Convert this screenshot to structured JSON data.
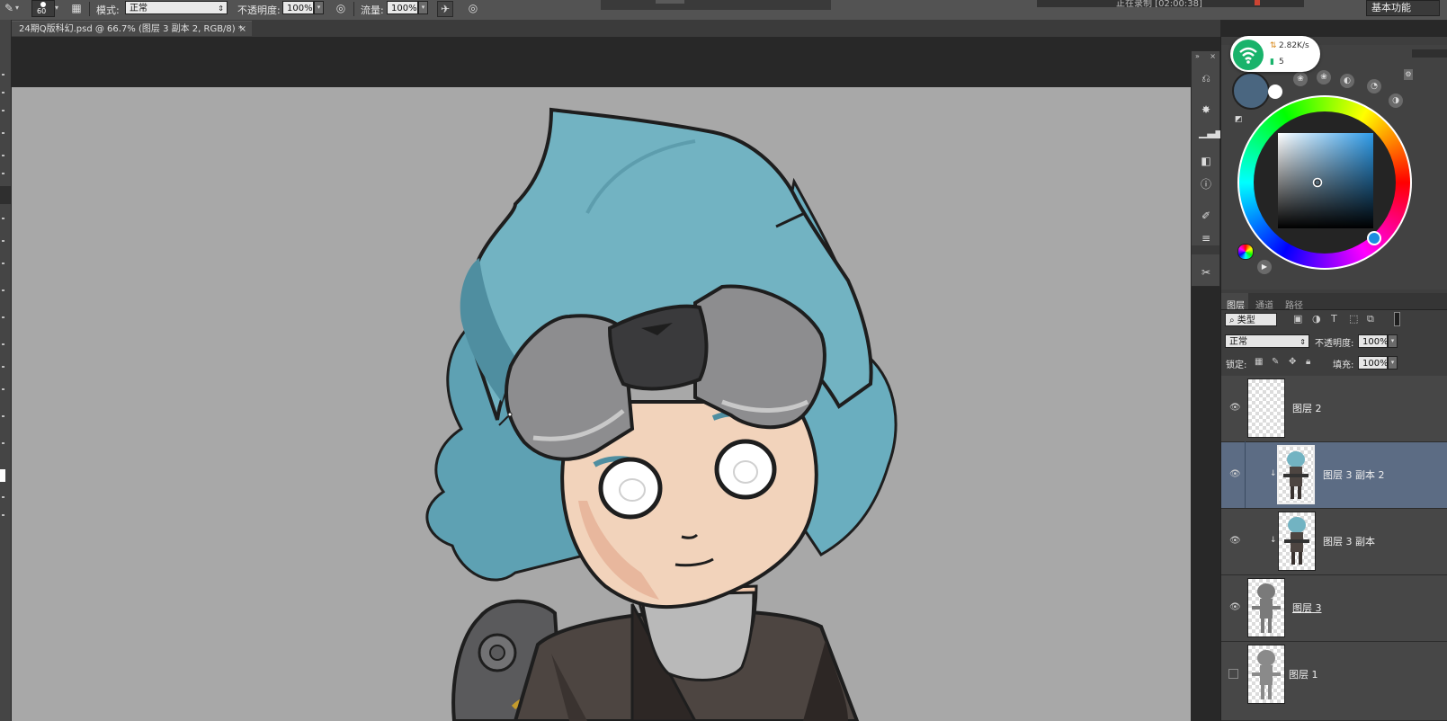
{
  "options_bar": {
    "brush_size": "60",
    "mode_label": "模式:",
    "mode_value": "正常",
    "opacity_label": "不透明度:",
    "opacity_value": "100%",
    "flow_label": "流量:",
    "flow_value": "100%",
    "recording_text": "正在录制 [02:00:38]",
    "workspace_button": "基本功能"
  },
  "document_tab": {
    "title": "24期Q版科幻.psd @ 66.7% (图层 3 副本 2, RGB/8) *",
    "close": "×"
  },
  "network_widget": {
    "speed": "2.82K/s",
    "count": "5",
    "accent": "#19b36b"
  },
  "color_panel": {
    "foreground_color": "#4a6680",
    "background_color": "#ffffff"
  },
  "layers_panel": {
    "tabs": [
      "图层",
      "通道",
      "路径"
    ],
    "filter_label": "类型",
    "blend_mode": "正常",
    "opacity_label": "不透明度:",
    "opacity_value": "100%",
    "lock_label": "锁定:",
    "fill_label": "填充:",
    "fill_value": "100%",
    "layers": [
      {
        "name": "图层 2",
        "visible": true,
        "selected": false
      },
      {
        "name": "图层 3 副本 2",
        "visible": true,
        "selected": true
      },
      {
        "name": "图层 3 副本",
        "visible": true,
        "selected": false
      },
      {
        "name": "图层 3",
        "visible": true,
        "selected": false
      },
      {
        "name": "图层 1",
        "visible": false,
        "selected": false
      }
    ]
  },
  "colors": {
    "hair": "#72b3c2",
    "hair_shadow": "#4f8ea0",
    "goggles": "#8d8d8f",
    "skin": "#f2d3bb",
    "jacket": "#4d4541",
    "canvas_bg": "#a8a8a8",
    "selection": "#5c6c84"
  }
}
